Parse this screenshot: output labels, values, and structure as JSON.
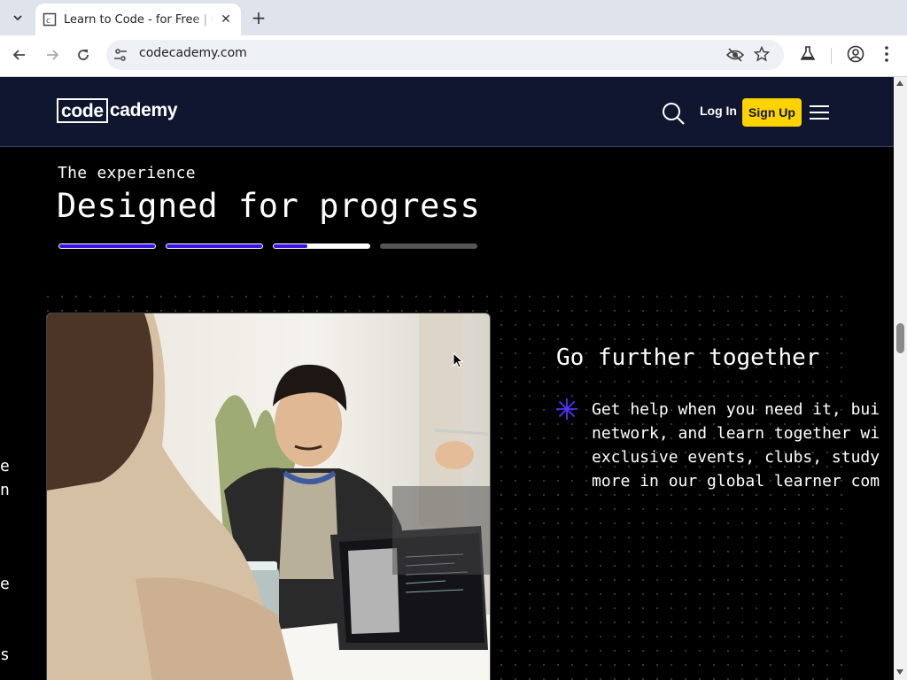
{
  "browser": {
    "tab_title": "Learn to Code - for Free | Codecademy",
    "url": "codecademy.com"
  },
  "header": {
    "logo_code": "code",
    "logo_rest": "cademy",
    "login_label": "Log In",
    "signup_label": "Sign Up"
  },
  "section": {
    "eyebrow": "The experience",
    "title": "Designed for progress",
    "progress_steps": [
      1,
      1,
      0.35,
      0
    ]
  },
  "feature": {
    "title": "Go further together",
    "lines": [
      "Get help when you need it, bui",
      "network, and learn together wi",
      "exclusive events, clubs, study",
      "more in our global learner com"
    ]
  },
  "left_slivers": [
    "e",
    "n",
    "e",
    "s"
  ],
  "colors": {
    "header_bg": "#10162f",
    "signup_bg": "#ffd300",
    "accent": "#3a10e5"
  }
}
